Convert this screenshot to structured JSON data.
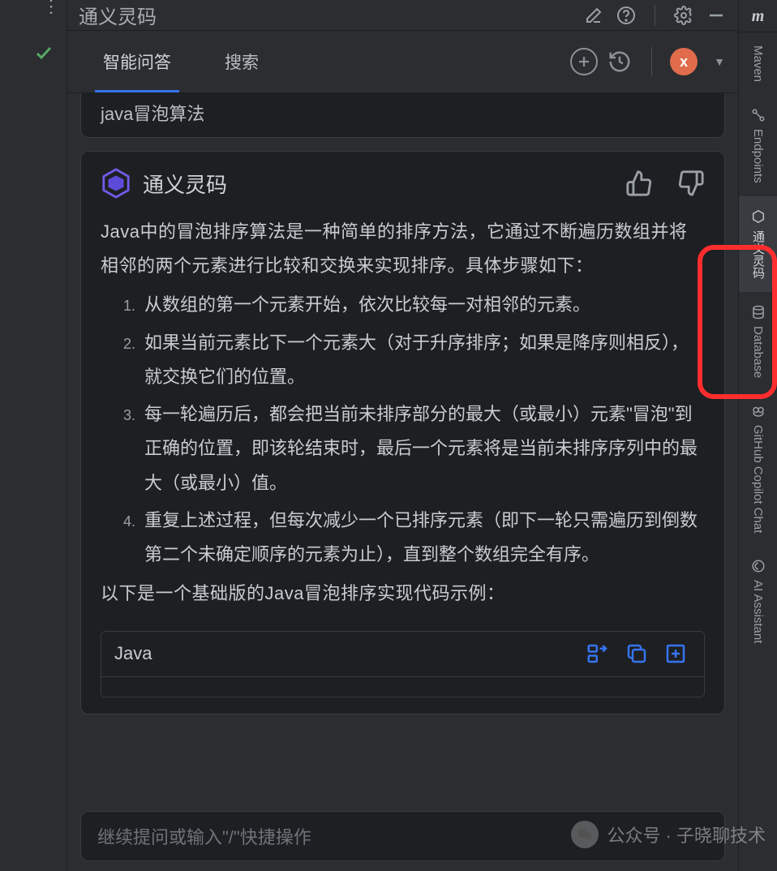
{
  "panel": {
    "title": "通义灵码",
    "tabs": {
      "qa": "智能问答",
      "search": "搜索"
    },
    "avatar_letter": "x"
  },
  "user_msg": "java冒泡算法",
  "assistant": {
    "name": "通义灵码",
    "intro": "Java中的冒泡排序算法是一种简单的排序方法，它通过不断遍历数组并将相邻的两个元素进行比较和交换来实现排序。具体步骤如下：",
    "steps": [
      "从数组的第一个元素开始，依次比较每一对相邻的元素。",
      "如果当前元素比下一个元素大（对于升序排序；如果是降序则相反），就交换它们的位置。",
      "每一轮遍历后，都会把当前未排序部分的最大（或最小）元素\"冒泡\"到正确的位置，即该轮结束时，最后一个元素将是当前未排序序列中的最大（或最小）值。",
      "重复上述过程，但每次减少一个已排序元素（即下一轮只需遍历到倒数第二个未确定顺序的元素为止），直到整个数组完全有序。"
    ],
    "outro": "以下是一个基础版的Java冒泡排序实现代码示例：",
    "code_lang": "Java"
  },
  "input_placeholder": "继续提问或输入\"/\"快捷操作",
  "right_bar": {
    "maven": "Maven",
    "endpoints": "Endpoints",
    "tongyi": "通义灵码",
    "database": "Database",
    "copilot": "GitHub Copilot Chat",
    "ai_assistant": "AI Assistant"
  },
  "watermark": "公众号 · 子晓聊技术"
}
